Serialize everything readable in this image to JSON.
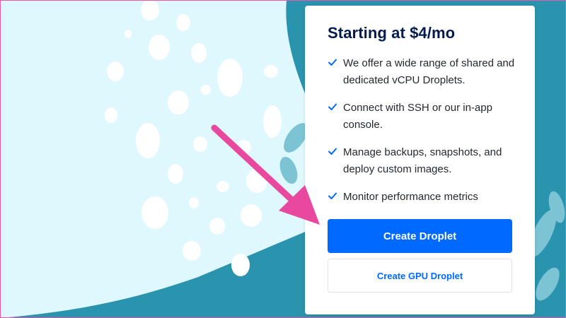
{
  "pricing_card": {
    "title": "Starting at $4/mo",
    "features": [
      {
        "text": "We offer a wide range of shared and dedicated vCPU Droplets.",
        "icon": "check-icon"
      },
      {
        "text": "Connect with SSH or our in-app console.",
        "icon": "check-icon"
      },
      {
        "text": "Manage backups, snapshots, and deploy custom images.",
        "icon": "check-icon"
      },
      {
        "text": "Monitor performance metrics",
        "icon": "check-icon"
      }
    ],
    "primary_button": "Create Droplet",
    "secondary_button": "Create GPU Droplet"
  },
  "annotation": {
    "icon": "arrow-icon",
    "color": "#e8489e"
  },
  "colors": {
    "brand_blue": "#0069ff",
    "title_navy": "#031b4e",
    "background_teal": "#2a93ad",
    "background_light": "#dff8fd"
  }
}
